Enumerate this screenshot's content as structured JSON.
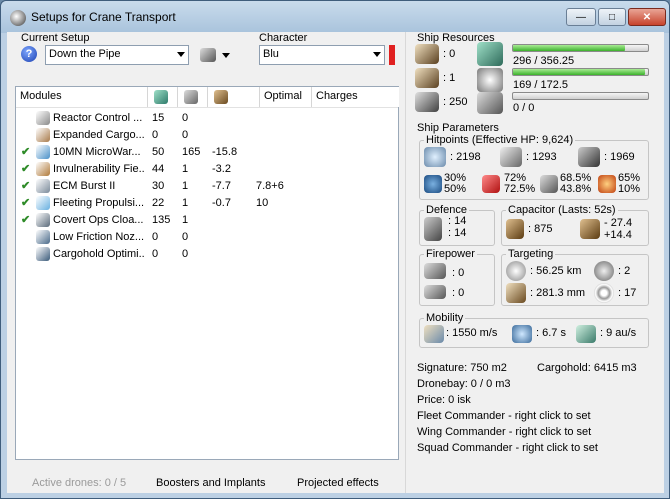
{
  "window": {
    "title": "Setups for Crane Transport"
  },
  "setup": {
    "label": "Current Setup",
    "value": "Down the Pipe"
  },
  "character": {
    "label": "Character",
    "value": "Blu"
  },
  "modules": {
    "headers": [
      "Modules",
      "Optimal",
      "Charges"
    ],
    "rows": [
      {
        "checked": false,
        "name": "Reactor Control ...",
        "c1": "15",
        "c2": "0",
        "c3": "",
        "opt": "",
        "icon": "reactor-icon",
        "color": "#8a8a8a"
      },
      {
        "checked": false,
        "name": "Expanded Cargo...",
        "c1": "0",
        "c2": "0",
        "c3": "",
        "opt": "",
        "icon": "cargo-icon",
        "color": "#a87a4a"
      },
      {
        "checked": true,
        "name": "10MN MicroWar...",
        "c1": "50",
        "c2": "165",
        "c3": "-15.8",
        "opt": "",
        "icon": "microwarp-icon",
        "color": "#4a90c8"
      },
      {
        "checked": true,
        "name": "Invulnerability Fie...",
        "c1": "44",
        "c2": "1",
        "c3": "-3.2",
        "opt": "",
        "icon": "invulnerability-icon",
        "color": "#b07a3a"
      },
      {
        "checked": true,
        "name": "ECM Burst II",
        "c1": "30",
        "c2": "1",
        "c3": "-7.7",
        "opt": "7.8+6",
        "icon": "ecm-icon",
        "color": "#7a8a9a"
      },
      {
        "checked": true,
        "name": "Fleeting Propulsi...",
        "c1": "22",
        "c2": "1",
        "c3": "-0.7",
        "opt": "10",
        "icon": "propulsion-icon",
        "color": "#68b0e0"
      },
      {
        "checked": true,
        "name": "Covert Ops Cloa...",
        "c1": "135",
        "c2": "1",
        "c3": "",
        "opt": "",
        "icon": "cloak-icon",
        "color": "#5a6a7a"
      },
      {
        "checked": false,
        "name": "Low Friction Noz...",
        "c1": "0",
        "c2": "0",
        "c3": "",
        "opt": "",
        "icon": "nozzle-icon",
        "color": "#4a6a8a"
      },
      {
        "checked": false,
        "name": "Cargohold Optimi...",
        "c1": "0",
        "c2": "0",
        "c3": "",
        "opt": "",
        "icon": "cargo-optimizer-icon",
        "color": "#3a5a7a"
      }
    ]
  },
  "resources": {
    "title": "Ship Resources",
    "high": "0",
    "med": "1",
    "low": "250",
    "cpu": {
      "text": "296 / 356.25",
      "pct": 83
    },
    "power": {
      "text": "169 / 172.5",
      "pct": 98
    },
    "calib": {
      "text": "0 / 0",
      "pct": 0
    }
  },
  "params": {
    "title": "Ship Parameters",
    "hitpoints": {
      "title": "Hitpoints (Effective HP: 9,624)",
      "shield": ": 2198",
      "armor": ": 1293",
      "hull": ": 1969",
      "em": "30%\n50%",
      "therm": "72%\n72.5%",
      "kin": "68.5%\n43.8%",
      "exp": "65%\n10%"
    },
    "defence": {
      "title": "Defence",
      "v1": ": 14",
      "v2": ": 14"
    },
    "capacitor": {
      "title": "Capacitor (Lasts: 52s)",
      "amount": ": 875",
      "delta1": "- 27.4",
      "delta2": "+14.4"
    },
    "firepower": {
      "title": "Firepower",
      "v1": ": 0",
      "v2": ": 0"
    },
    "targeting": {
      "title": "Targeting",
      "range": ": 56.25 km",
      "targets": ": 2",
      "res": ": 281.3 mm",
      "sensor": ": 17"
    },
    "mobility": {
      "title": "Mobility",
      "speed": ": 1550 m/s",
      "align": ": 6.7 s",
      "warp": ": 9 au/s"
    },
    "signature": "Signature: 750 m2",
    "cargohold": "Cargohold: 6415 m3",
    "dronebay": "Dronebay: 0 / 0 m3",
    "price": "Price: 0 isk",
    "fleet": "Fleet Commander - right click to set",
    "wing": "Wing Commander - right click to set",
    "squad": "Squad Commander - right click to set"
  },
  "bottom": {
    "drones": "Active drones: 0 / 5",
    "boosters": "Boosters and Implants",
    "projected": "Projected effects"
  }
}
